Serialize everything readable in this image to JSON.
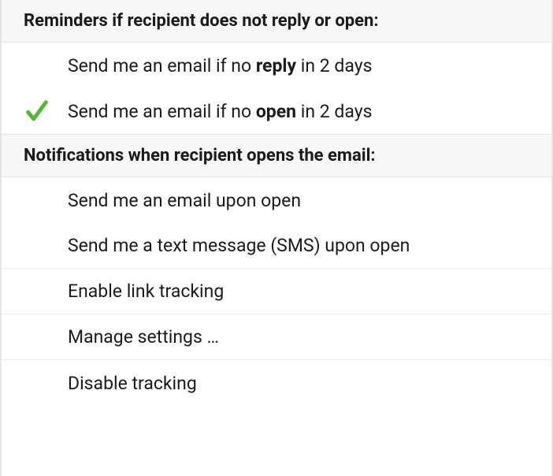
{
  "sections": {
    "reminders": {
      "header": "Reminders if recipient does not reply or open:",
      "items": {
        "no_reply": {
          "pre": "Send me an email if no ",
          "bold": "reply",
          "post": " in 2 days",
          "checked": false
        },
        "no_open": {
          "pre": "Send me an email if no ",
          "bold": "open",
          "post": " in 2 days",
          "checked": true
        }
      }
    },
    "notifications": {
      "header": "Notifications when recipient opens the email:",
      "items": {
        "email_on_open": {
          "label": "Send me an email upon open",
          "checked": false
        },
        "sms_on_open": {
          "label": "Send me a text message (SMS) upon open",
          "checked": false
        }
      }
    }
  },
  "extras": {
    "link_tracking": "Enable link tracking",
    "manage_settings": "Manage settings …",
    "disable_tracking": "Disable tracking"
  }
}
